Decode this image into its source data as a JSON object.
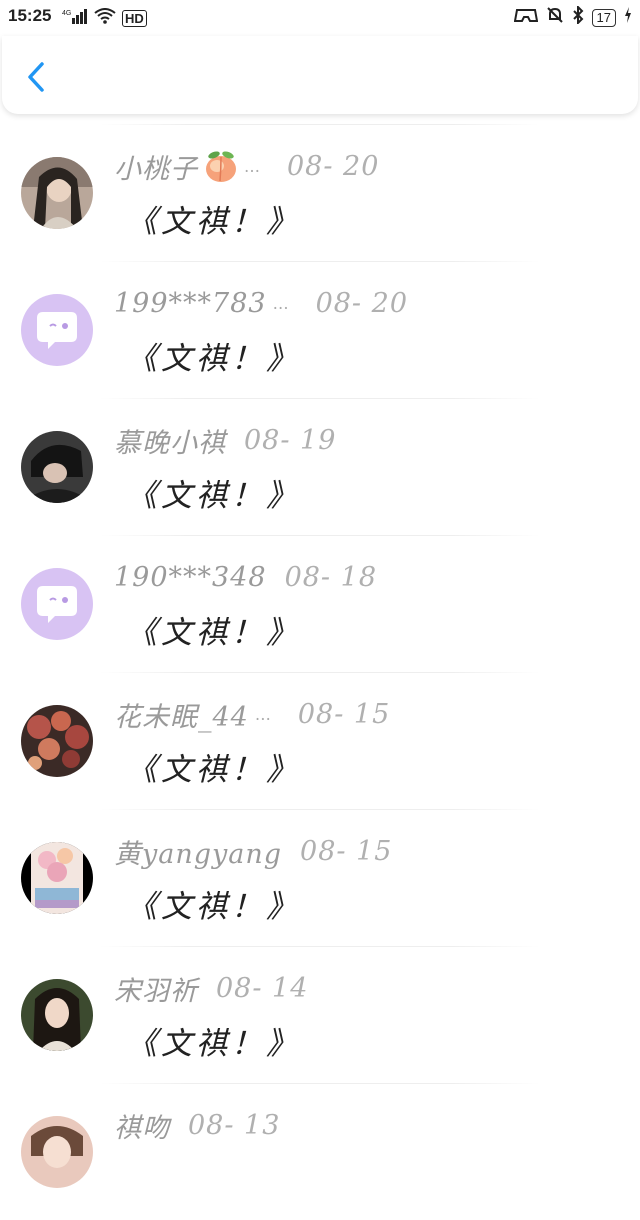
{
  "status": {
    "time": "15:25",
    "network": "4G",
    "hd": "HD",
    "battery": "17"
  },
  "header": {
    "back_icon": "chevron-left-icon",
    "accent": "#2196f3"
  },
  "items": [
    {
      "name": "小桃子",
      "emoji": "peach",
      "ellipsis": "…",
      "date": "08- 20",
      "message": "《文祺！》",
      "avatar": "portrait-longhair"
    },
    {
      "name": "199***783",
      "ellipsis": "…",
      "date": "08- 20",
      "message": "《文祺！》",
      "avatar": "default-chat-bubble"
    },
    {
      "name": "慕晚小祺",
      "date": "08- 19",
      "message": "《文祺！》",
      "avatar": "portrait-dark"
    },
    {
      "name": "190***348",
      "date": "08- 18",
      "message": "《文祺！》",
      "avatar": "default-chat-bubble"
    },
    {
      "name": "花未眠_44",
      "ellipsis": "…",
      "date": "08- 15",
      "message": "《文祺！》",
      "avatar": "autumn-leaves"
    },
    {
      "name": "黄yangyang",
      "date": "08- 15",
      "message": "《文祺！》",
      "avatar": "blossom-painting"
    },
    {
      "name": "宋羽祈",
      "date": "08- 14",
      "message": "《文祺！》",
      "avatar": "portrait-woman"
    },
    {
      "name": "祺吻",
      "date": "08- 13",
      "message": "",
      "avatar": "portrait-light"
    }
  ]
}
